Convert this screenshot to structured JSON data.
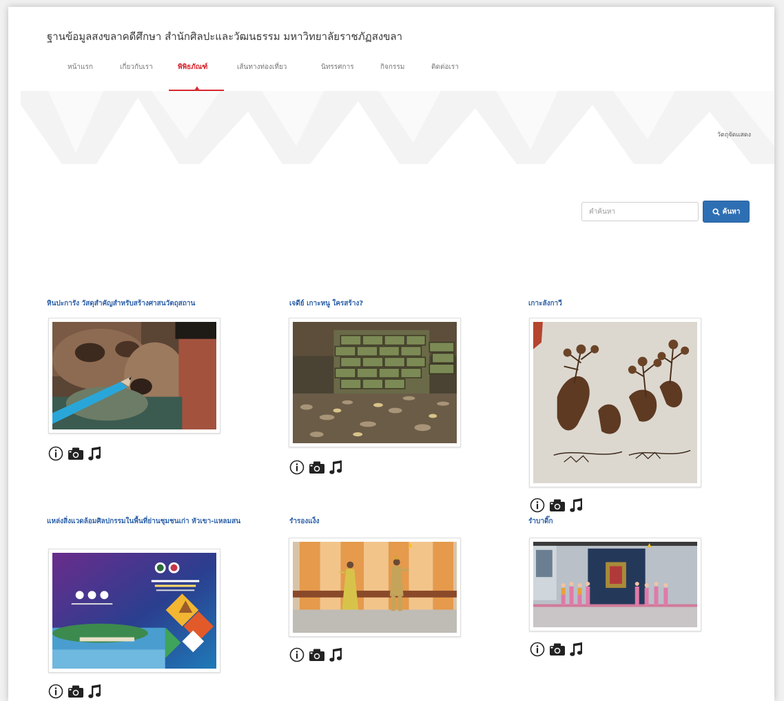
{
  "site": {
    "title": "ฐานข้อมูลสงขลาคดีศึกษา สำนักศิลปะและวัฒนธรรม มหาวิทยาลัยราชภัฏสงขลา"
  },
  "nav": {
    "items": [
      {
        "label": "หน้าแรก"
      },
      {
        "label": "เกี่ยวกับเรา"
      },
      {
        "label": "พิพิธภัณฑ์"
      },
      {
        "label": "เส้นทางท่องเที่ยว"
      },
      {
        "label": "นิทรรศการ"
      },
      {
        "label": "กิจกรรม"
      },
      {
        "label": "ติดต่อเรา"
      }
    ],
    "active_index": 2
  },
  "banner": {
    "label": "วัตถุจัดแสดง"
  },
  "search": {
    "placeholder": "คำค้นหา",
    "button_label": "ค้นหา"
  },
  "colors": {
    "accent_red": "#d9272e",
    "link_blue": "#2f62a8",
    "button_blue": "#2e6fb4"
  },
  "cards": [
    {
      "title": "หินปะการัง วัสดุสำคัญสำหรับสร้างศาสนวัตถุสถาน",
      "icons": [
        "info-icon",
        "camera-icon",
        "music-note-icon"
      ]
    },
    {
      "title": "เจดีย์ เกาะหนู ใครสร้าง?",
      "icons": [
        "info-icon",
        "camera-icon",
        "music-note-icon"
      ]
    },
    {
      "title": "เกาะลังกาวี",
      "icons": [
        "info-icon",
        "camera-icon",
        "music-note-icon"
      ]
    },
    {
      "title": "แหล่งสิ่งแวดล้อมศิลปกรรมในพื้นที่ย่านชุมชนเก่า หัวเขา-แหลมสน",
      "icons": [
        "info-icon",
        "camera-icon",
        "music-note-icon"
      ]
    },
    {
      "title": "รำรองแง็ง",
      "icons": [
        "info-icon",
        "camera-icon",
        "music-note-icon"
      ]
    },
    {
      "title": "รำบาดิ๊ก",
      "icons": [
        "info-icon",
        "camera-icon",
        "music-note-icon"
      ]
    }
  ]
}
